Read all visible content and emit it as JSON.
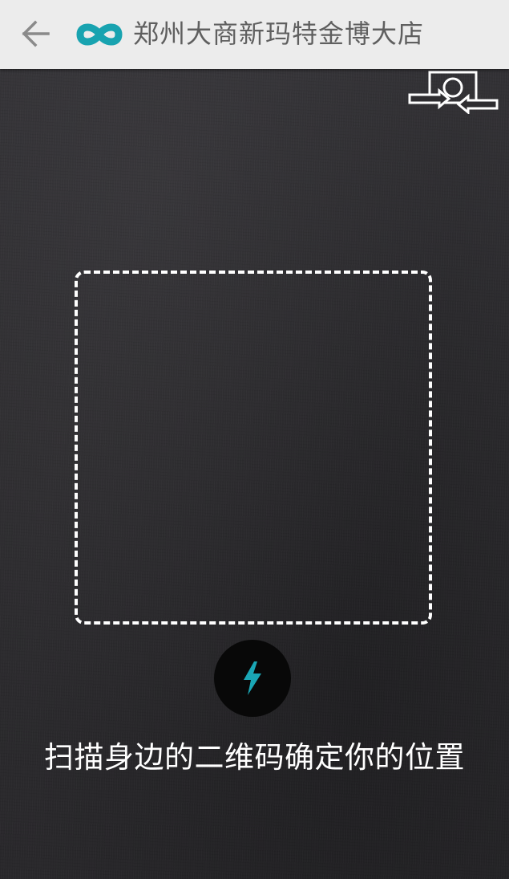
{
  "header": {
    "title": "郑州大商新玛特金博大店",
    "back_icon": "arrow-left-icon",
    "logo_icon": "infinity-logo-icon",
    "logo_color": "#18a3b0",
    "background": "#ececec"
  },
  "scanner": {
    "camera_switch_icon": "camera-switch-icon",
    "flash_icon": "lightning-bolt-icon",
    "flash_color": "#1aa6b5",
    "hint": "扫描身边的二维码确定你的位置"
  }
}
